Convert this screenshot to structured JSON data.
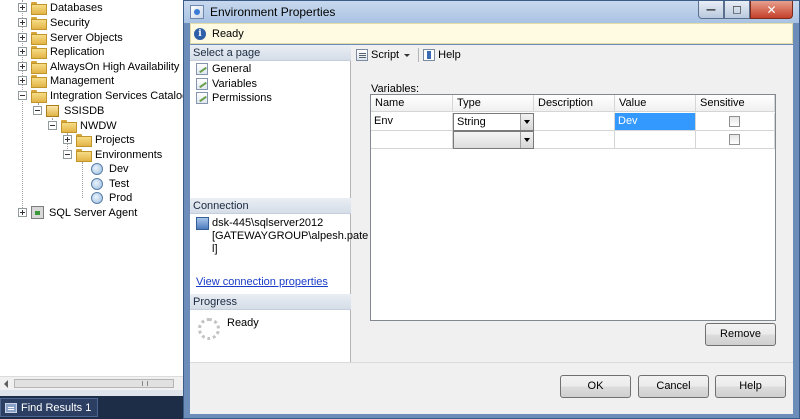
{
  "object_explorer": {
    "nodes": [
      {
        "label": "Databases",
        "expander": "plus",
        "icon": "folder-icon"
      },
      {
        "label": "Security",
        "expander": "plus",
        "icon": "folder-icon"
      },
      {
        "label": "Server Objects",
        "expander": "plus",
        "icon": "folder-icon"
      },
      {
        "label": "Replication",
        "expander": "plus",
        "icon": "folder-icon"
      },
      {
        "label": "AlwaysOn High Availability",
        "expander": "plus",
        "icon": "folder-icon"
      },
      {
        "label": "Management",
        "expander": "plus",
        "icon": "folder-icon"
      },
      {
        "label": "Integration Services Catalogs",
        "expander": "minus",
        "icon": "folder-icon"
      },
      {
        "label": "SSISDB",
        "expander": "minus",
        "icon": "ssisdb-icon"
      },
      {
        "label": "NWDW",
        "expander": "minus",
        "icon": "folder-icon"
      },
      {
        "label": "Projects",
        "expander": "plus",
        "icon": "folder-icon"
      },
      {
        "label": "Environments",
        "expander": "minus",
        "icon": "folder-icon"
      },
      {
        "label": "Dev",
        "expander": "none",
        "icon": "environment-icon"
      },
      {
        "label": "Test",
        "expander": "none",
        "icon": "environment-icon"
      },
      {
        "label": "Prod",
        "expander": "none",
        "icon": "environment-icon"
      },
      {
        "label": "SQL Server Agent",
        "expander": "plus",
        "icon": "sql-agent-icon"
      }
    ]
  },
  "bottom_tab": {
    "label": "Find Results 1"
  },
  "dialog": {
    "title": "Environment Properties",
    "status": "Ready",
    "select_page": {
      "header": "Select a page",
      "items": [
        "General",
        "Variables",
        "Permissions"
      ]
    },
    "connection": {
      "header": "Connection",
      "server": "dsk-445\\sqlserver2012",
      "user_line1": "[GATEWAYGROUP\\alpesh.pate",
      "user_line2": "l]",
      "link": "View connection properties"
    },
    "progress": {
      "header": "Progress",
      "status": "Ready"
    },
    "toolbar": {
      "script_label": "Script",
      "help_label": "Help"
    },
    "variables": {
      "label": "Variables:",
      "columns": [
        "Name",
        "Type",
        "Description",
        "Value",
        "Sensitive"
      ],
      "rows": [
        {
          "name": "Env",
          "type": "String",
          "description": "",
          "value": "Dev",
          "sensitive": false
        },
        {
          "name": "",
          "type": "",
          "description": "",
          "value": "",
          "sensitive": false
        }
      ]
    },
    "buttons": {
      "remove": "Remove",
      "ok": "OK",
      "cancel": "Cancel",
      "help": "Help"
    },
    "window_buttons": {
      "minimize": "—",
      "maximize": "□",
      "close": "✕"
    }
  }
}
